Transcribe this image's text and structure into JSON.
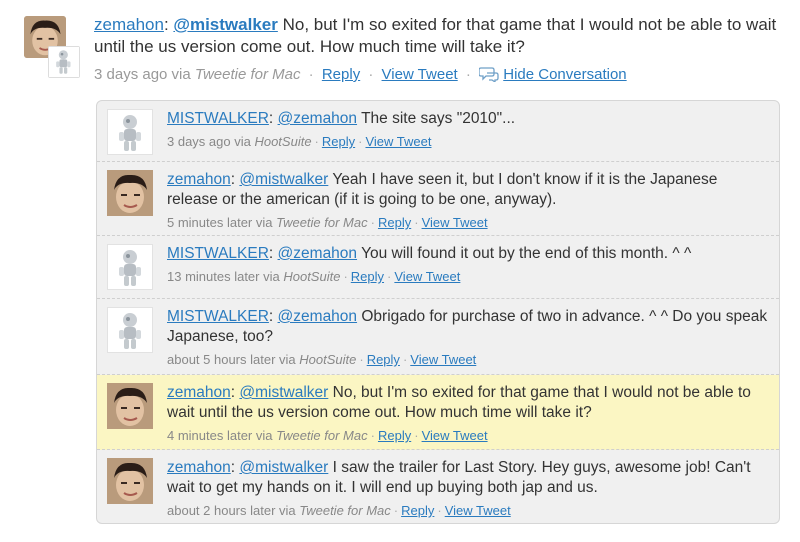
{
  "header_tweet": {
    "username": "zemahon",
    "mention": "@mistwalker",
    "text": " No, but I'm so exited for that game that I would not be able to wait until the us version come out. How much time will take it?",
    "time": "3 days ago via ",
    "client": "Tweetie for Mac",
    "reply_label": "Reply",
    "view_label": "View Tweet",
    "hide_label": "Hide Conversation"
  },
  "conversation": [
    {
      "user": "MISTWALKER",
      "mention": "@zemahon",
      "text": " The site says \"2010\"...",
      "time": "3 days ago via ",
      "client": "HootSuite",
      "reply": "Reply",
      "view": "View Tweet",
      "avatar": "bot"
    },
    {
      "user": "zemahon",
      "mention": "@mistwalker",
      "text": " Yeah I have seen it, but I don't know if it is the Japanese release or the american (if it is going to be one, anyway).",
      "time": "5 minutes later via ",
      "client": "Tweetie for Mac",
      "reply": "Reply",
      "view": "View Tweet",
      "avatar": "face"
    },
    {
      "user": "MISTWALKER",
      "mention": "@zemahon",
      "text": " You will found it out by the end of this month. ^ ^",
      "time": "13 minutes later via ",
      "client": "HootSuite",
      "reply": "Reply",
      "view": "View Tweet",
      "avatar": "bot"
    },
    {
      "user": "MISTWALKER",
      "mention": "@zemahon",
      "text": " Obrigado for purchase of two in advance. ^ ^ Do you speak Japanese, too?",
      "time": "about 5 hours later via ",
      "client": "HootSuite",
      "reply": "Reply",
      "view": "View Tweet",
      "avatar": "bot"
    },
    {
      "user": "zemahon",
      "mention": "@mistwalker",
      "text": " No, but I'm so exited for that game that I would not be able to wait until the us version come out. How much time will take it?",
      "time": "4 minutes later via ",
      "client": "Tweetie for Mac",
      "reply": "Reply",
      "view": "View Tweet",
      "avatar": "face",
      "highlight": true
    },
    {
      "user": "zemahon",
      "mention": "@mistwalker",
      "text": " I saw the trailer for Last Story. Hey guys, awesome job! Can't wait to get my hands on it. I will end up buying both jap and us.",
      "time": "about 2 hours later via ",
      "client": "Tweetie for Mac",
      "reply": "Reply",
      "view": "View Tweet",
      "avatar": "face"
    }
  ],
  "colors": {
    "link": "#2a7bbf",
    "highlight": "#fbf6c3",
    "panel": "#f0f0f0"
  }
}
